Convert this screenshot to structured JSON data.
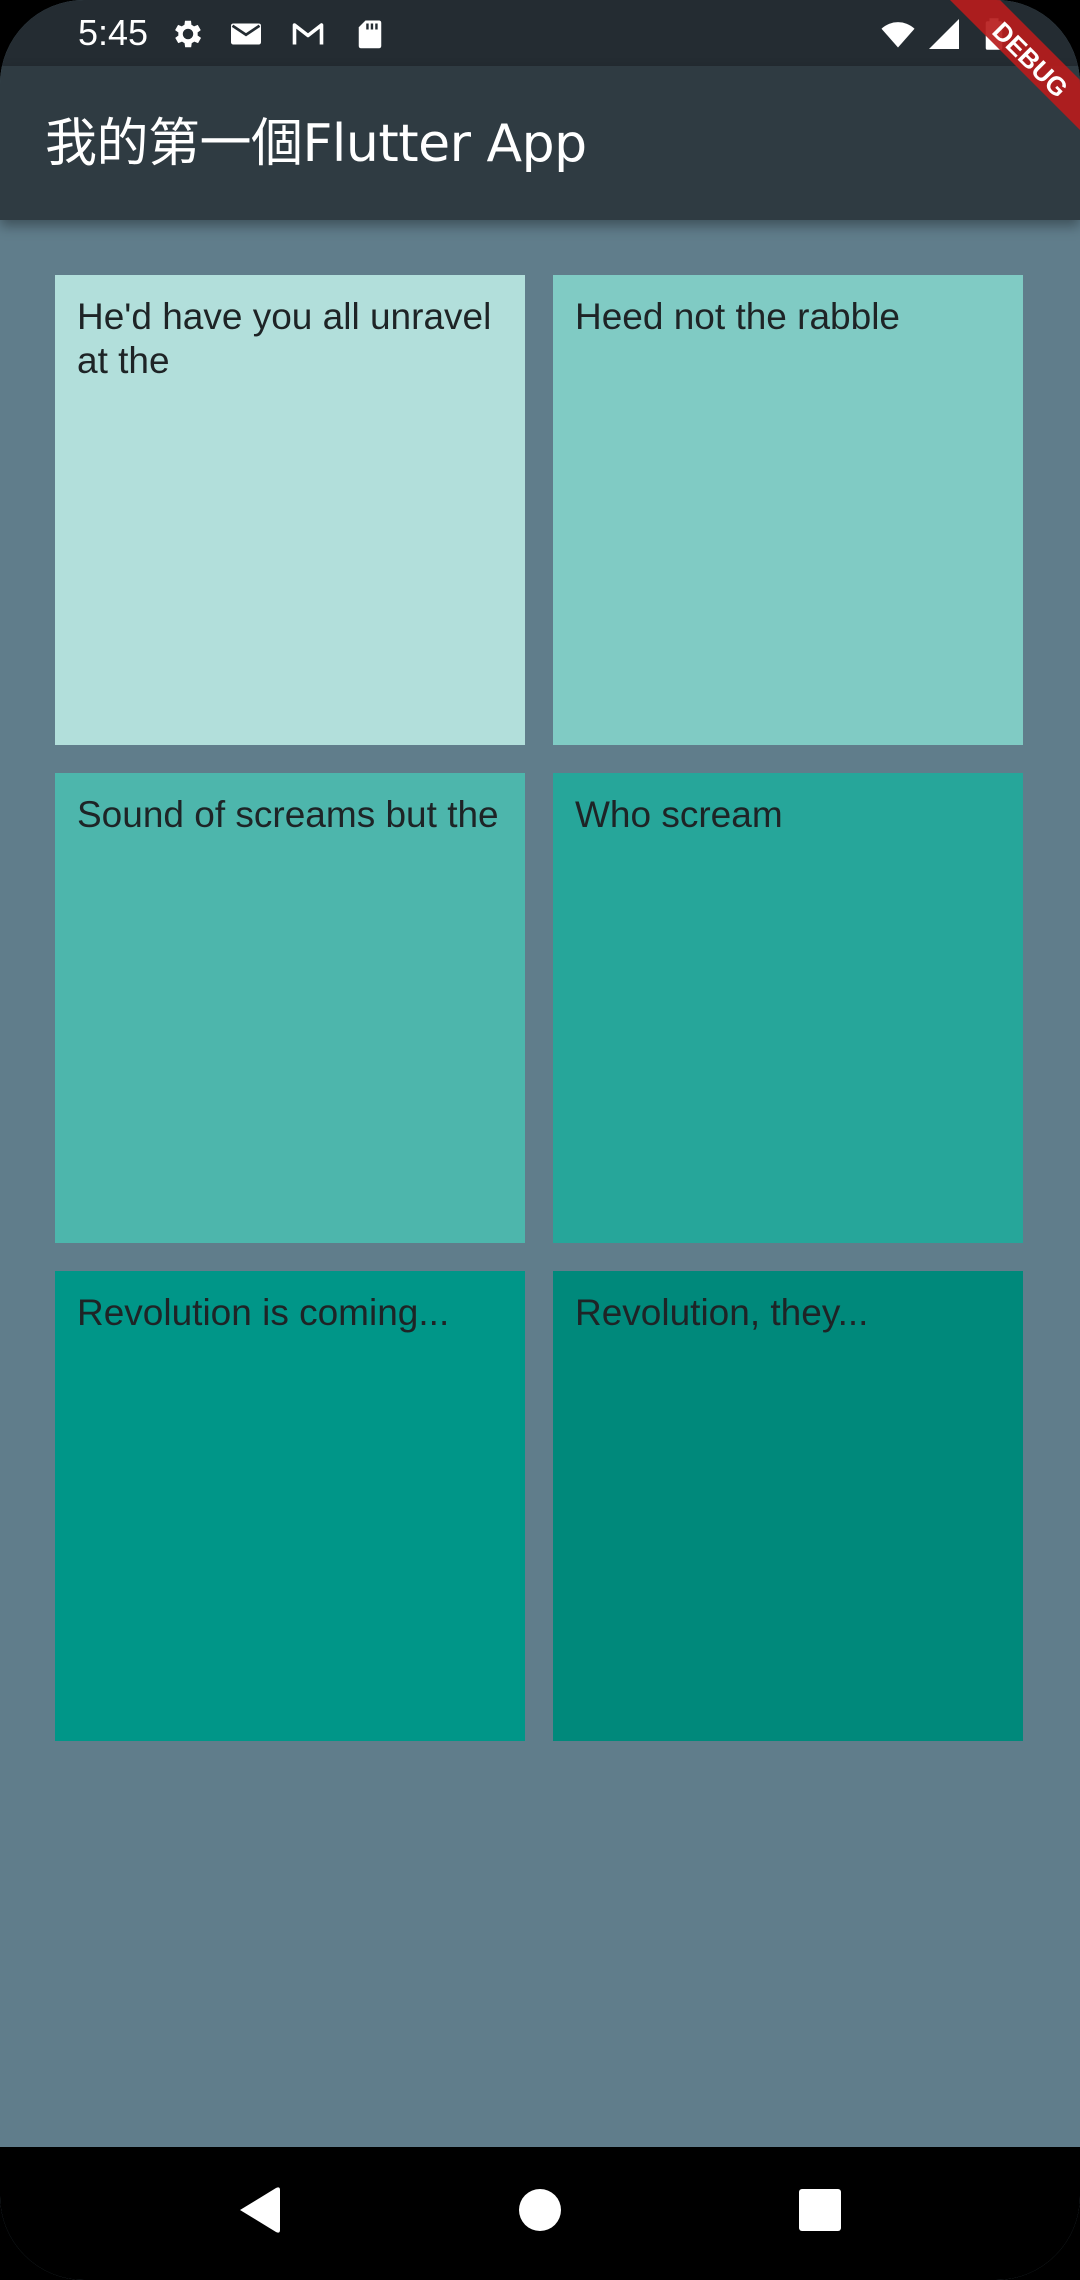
{
  "status_bar": {
    "time": "5:45",
    "left_icons": [
      "settings-icon",
      "mail-icon",
      "gmail-icon",
      "sd-card-icon"
    ],
    "right_icons": [
      "wifi-icon",
      "signal-icon",
      "battery-icon"
    ]
  },
  "app_bar": {
    "title": "我的第一個Flutter App",
    "background_color": "#2F3B42"
  },
  "debug_banner": {
    "label": "DEBUG",
    "color": "#B71C1C"
  },
  "page": {
    "background_color": "#607D8B"
  },
  "grid": {
    "tiles": [
      {
        "text": "He'd have you all unravel at the",
        "color": "#B2DFDB"
      },
      {
        "text": "Heed not the rabble",
        "color": "#80CBC4"
      },
      {
        "text": "Sound of screams but the",
        "color": "#4DB6AC"
      },
      {
        "text": "Who scream",
        "color": "#26A69A"
      },
      {
        "text": "Revolution is coming...",
        "color": "#009688"
      },
      {
        "text": "Revolution, they...",
        "color": "#00897B"
      }
    ]
  },
  "nav_bar": {
    "buttons": [
      "back-icon",
      "home-icon",
      "recents-icon"
    ]
  }
}
